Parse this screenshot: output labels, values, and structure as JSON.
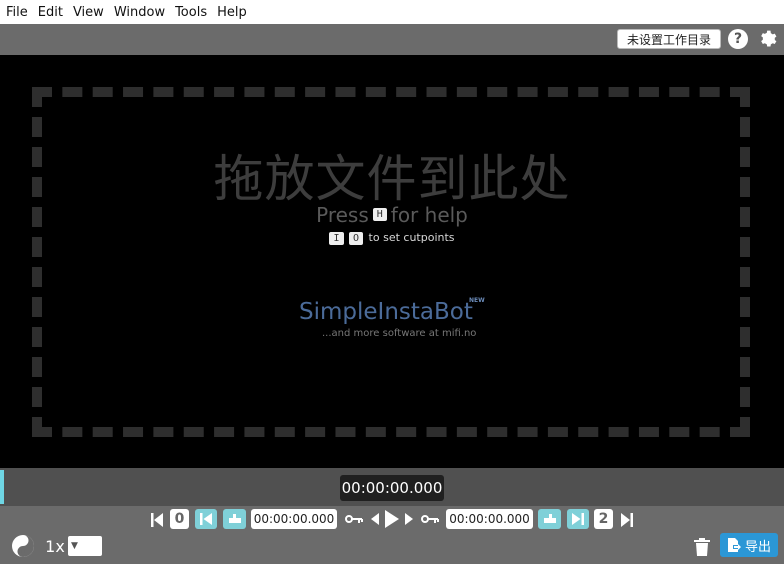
{
  "menu": [
    "File",
    "Edit",
    "View",
    "Window",
    "Tools",
    "Help"
  ],
  "toolbar": {
    "workdir_label": "未设置工作目录",
    "help_label": "?"
  },
  "dropzone": {
    "title": "拖放文件到此处",
    "press_prefix": "Press",
    "press_key": "H",
    "press_suffix": "for help",
    "cut_key_in": "I",
    "cut_key_out": "O",
    "cut_text": "to set cutpoints"
  },
  "promo": {
    "name": "SimpleInstaBot",
    "badge": "NEW",
    "sub": "...and more software at mifi.no"
  },
  "timeline": {
    "current_time": "00:00:00.000"
  },
  "controls": {
    "segment_start_badge": "0",
    "start_time": "00:00:00.000",
    "end_time": "00:00:00.000",
    "segment_end_badge": "2",
    "playback_rate": "1x",
    "export_label": "导出"
  },
  "colors": {
    "accent_cyan": "#7fd0d8",
    "export_blue": "#2b97d6",
    "toolbar_gray": "#6b6b6b"
  }
}
